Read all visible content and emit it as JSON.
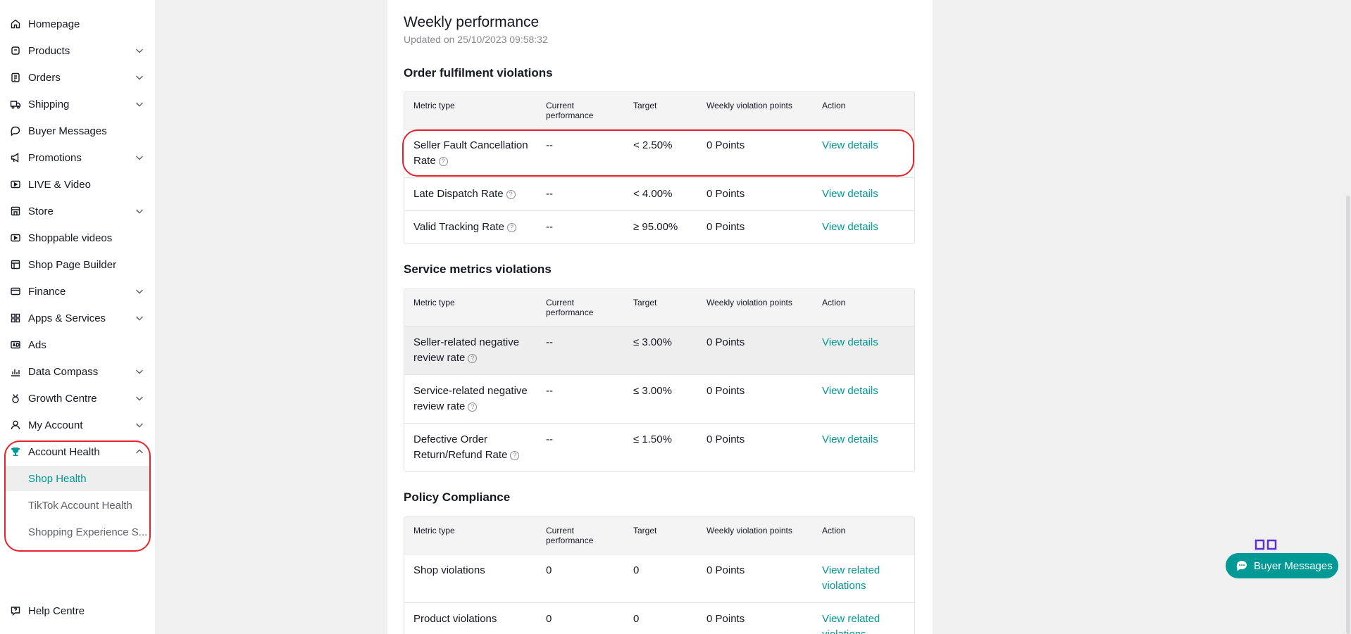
{
  "sidebar": {
    "items": [
      {
        "label": "Homepage",
        "icon": "home-icon",
        "chevron": false
      },
      {
        "label": "Products",
        "icon": "box-icon",
        "chevron": true
      },
      {
        "label": "Orders",
        "icon": "clipboard-icon",
        "chevron": true
      },
      {
        "label": "Shipping",
        "icon": "truck-icon",
        "chevron": true
      },
      {
        "label": "Buyer Messages",
        "icon": "chat-bubble-icon",
        "chevron": false
      },
      {
        "label": "Promotions",
        "icon": "megaphone-icon",
        "chevron": true
      },
      {
        "label": "LIVE & Video",
        "icon": "video-icon",
        "chevron": false
      },
      {
        "label": "Store",
        "icon": "store-icon",
        "chevron": true
      },
      {
        "label": "Shoppable videos",
        "icon": "play-video-icon",
        "chevron": false
      },
      {
        "label": "Shop Page Builder",
        "icon": "page-builder-icon",
        "chevron": false
      },
      {
        "label": "Finance",
        "icon": "wallet-icon",
        "chevron": true
      },
      {
        "label": "Apps & Services",
        "icon": "apps-grid-icon",
        "chevron": true
      },
      {
        "label": "Ads",
        "icon": "ads-icon",
        "chevron": false
      },
      {
        "label": "Data Compass",
        "icon": "bar-chart-icon",
        "chevron": true
      },
      {
        "label": "Growth Centre",
        "icon": "medal-icon",
        "chevron": true
      },
      {
        "label": "My Account",
        "icon": "user-icon",
        "chevron": true
      },
      {
        "label": "Account Health",
        "icon": "trophy-icon",
        "chevron": true,
        "expanded": true
      }
    ],
    "sub_items": [
      {
        "label": "Shop Health",
        "active": true
      },
      {
        "label": "TikTok Account Health",
        "active": false
      },
      {
        "label": "Shopping Experience S...",
        "active": false
      }
    ],
    "help": {
      "label": "Help Centre",
      "icon": "help-centre-icon"
    }
  },
  "main": {
    "title": "Weekly performance",
    "updated": "Updated on 25/10/2023 09:58:32",
    "headers": {
      "metric": "Metric type",
      "current_line1": "Current",
      "current_line2": "performance",
      "target": "Target",
      "points": "Weekly violation points",
      "action": "Action"
    },
    "sections": [
      {
        "title": "Order fulfilment violations",
        "rows": [
          {
            "metric_l1": "Seller Fault Cancellation",
            "metric_l2": "Rate",
            "current": "--",
            "target": "< 2.50%",
            "points": "0 Points",
            "action_l1": "View details",
            "action_l2": ""
          },
          {
            "metric_l1": "Late Dispatch Rate",
            "metric_l2": "",
            "current": "--",
            "target": "< 4.00%",
            "points": "0 Points",
            "action_l1": "View details",
            "action_l2": ""
          },
          {
            "metric_l1": "Valid Tracking Rate",
            "metric_l2": "",
            "current": "--",
            "target": "≥ 95.00%",
            "points": "0 Points",
            "action_l1": "View details",
            "action_l2": ""
          }
        ]
      },
      {
        "title": "Service metrics violations",
        "rows": [
          {
            "metric_l1": "Seller-related negative",
            "metric_l2": "review rate",
            "current": "--",
            "target": "≤ 3.00%",
            "points": "0 Points",
            "action_l1": "View details",
            "action_l2": ""
          },
          {
            "metric_l1": "Service-related negative",
            "metric_l2": "review rate",
            "current": "--",
            "target": "≤ 3.00%",
            "points": "0 Points",
            "action_l1": "View details",
            "action_l2": ""
          },
          {
            "metric_l1": "Defective Order",
            "metric_l2": "Return/Refund Rate",
            "current": "--",
            "target": "≤ 1.50%",
            "points": "0 Points",
            "action_l1": "View details",
            "action_l2": ""
          }
        ]
      },
      {
        "title": "Policy Compliance",
        "rows": [
          {
            "metric_l1": "Shop violations",
            "metric_l2": "",
            "current": "0",
            "target": "0",
            "points": "0 Points",
            "action_l1": "View related",
            "action_l2": "violations"
          },
          {
            "metric_l1": "Product violations",
            "metric_l2": "",
            "current": "0",
            "target": "0",
            "points": "0 Points",
            "action_l1": "View related",
            "action_l2": "violations"
          }
        ]
      }
    ]
  },
  "floating": {
    "buyer_messages": "Buyer Messages"
  },
  "colors": {
    "accent": "#009995",
    "highlight_outline": "#e8232d",
    "qr_icon": "#5b2fd1"
  }
}
